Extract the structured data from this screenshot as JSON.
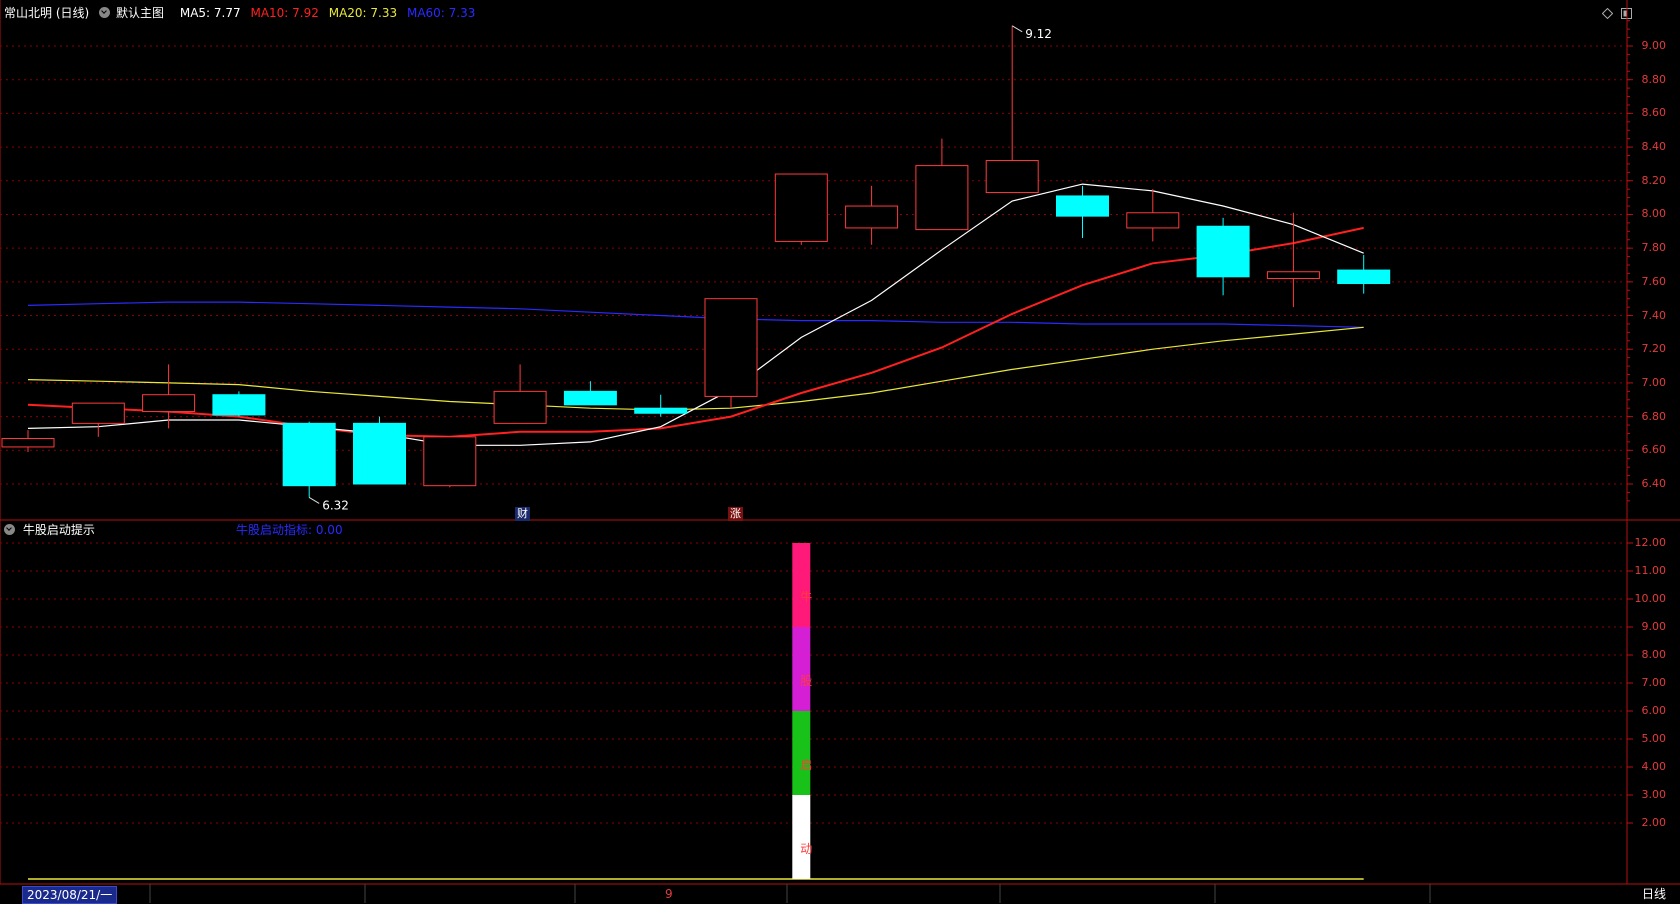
{
  "header": {
    "stock": "常山北明 (日线)",
    "template": "默认主图",
    "ma5": "MA5: 7.77",
    "ma10": "MA10: 7.92",
    "ma20": "MA20: 7.33",
    "ma60": "MA60: 7.33"
  },
  "colors": {
    "ma5": "#ffffff",
    "ma10": "#ff2020",
    "ma20": "#e8e83a",
    "ma60": "#2a2aff",
    "up": "#ff3b3b",
    "down": "#00ffff",
    "axis": "#e23c3c",
    "grid": "#8b0000"
  },
  "price_axis": [
    "9.00",
    "8.80",
    "8.60",
    "8.40",
    "8.20",
    "8.00",
    "7.80",
    "7.60",
    "7.40",
    "7.20",
    "7.00",
    "6.80",
    "6.60",
    "6.40"
  ],
  "annotations": {
    "high": "9.12",
    "low": "6.32",
    "tag_fin": "财",
    "tag_rise": "涨"
  },
  "chart_data": {
    "type": "candlestick",
    "candles": [
      {
        "o": 6.62,
        "c": 6.67,
        "h": 6.72,
        "l": 6.59
      },
      {
        "o": 6.76,
        "c": 6.88,
        "h": 6.88,
        "l": 6.68
      },
      {
        "o": 6.83,
        "c": 6.93,
        "h": 7.11,
        "l": 6.73
      },
      {
        "o": 6.93,
        "c": 6.81,
        "h": 6.95,
        "l": 6.8
      },
      {
        "o": 6.76,
        "c": 6.39,
        "h": 6.77,
        "l": 6.32
      },
      {
        "o": 6.76,
        "c": 6.4,
        "h": 6.8,
        "l": 6.4
      },
      {
        "o": 6.39,
        "c": 6.68,
        "h": 6.68,
        "l": 6.38
      },
      {
        "o": 6.76,
        "c": 6.95,
        "h": 7.11,
        "l": 6.76
      },
      {
        "o": 6.95,
        "c": 6.87,
        "h": 7.01,
        "l": 6.87
      },
      {
        "o": 6.85,
        "c": 6.82,
        "h": 6.93,
        "l": 6.8
      },
      {
        "o": 6.92,
        "c": 7.5,
        "h": 7.5,
        "l": 6.85
      },
      {
        "o": 7.84,
        "c": 8.24,
        "h": 8.24,
        "l": 7.82
      },
      {
        "o": 7.92,
        "c": 8.05,
        "h": 8.17,
        "l": 7.82
      },
      {
        "o": 7.91,
        "c": 8.29,
        "h": 8.45,
        "l": 7.91
      },
      {
        "o": 8.13,
        "c": 8.32,
        "h": 9.12,
        "l": 8.13
      },
      {
        "o": 8.11,
        "c": 7.99,
        "h": 8.17,
        "l": 7.86
      },
      {
        "o": 7.92,
        "c": 8.01,
        "h": 8.15,
        "l": 7.84
      },
      {
        "o": 7.93,
        "c": 7.63,
        "h": 7.98,
        "l": 7.52
      },
      {
        "o": 7.62,
        "c": 7.66,
        "h": 8.01,
        "l": 7.45
      },
      {
        "o": 7.67,
        "c": 7.59,
        "h": 7.76,
        "l": 7.53
      }
    ],
    "ma5": [
      6.73,
      6.74,
      6.78,
      6.78,
      6.74,
      6.7,
      6.63,
      6.63,
      6.65,
      6.74,
      6.96,
      7.27,
      7.49,
      7.79,
      8.08,
      8.18,
      8.14,
      8.05,
      7.94,
      7.77
    ],
    "ma10": [
      6.87,
      6.85,
      6.83,
      6.8,
      6.74,
      6.69,
      6.68,
      6.71,
      6.71,
      6.73,
      6.8,
      6.94,
      7.06,
      7.21,
      7.41,
      7.58,
      7.71,
      7.76,
      7.83,
      7.92
    ],
    "ma20": [
      7.02,
      7.01,
      7.0,
      6.99,
      6.95,
      6.92,
      6.89,
      6.87,
      6.85,
      6.84,
      6.85,
      6.89,
      6.94,
      7.01,
      7.08,
      7.14,
      7.2,
      7.25,
      7.29,
      7.33
    ],
    "ma60": [
      7.46,
      7.47,
      7.48,
      7.48,
      7.47,
      7.46,
      7.45,
      7.44,
      7.42,
      7.4,
      7.38,
      7.37,
      7.37,
      7.36,
      7.36,
      7.35,
      7.35,
      7.35,
      7.34,
      7.33
    ],
    "ylim": [
      6.3,
      9.2
    ]
  },
  "indicator": {
    "title": "牛股启动提示",
    "label": "牛股启动指标: 0.00",
    "axis": [
      "12.00",
      "11.00",
      "10.00",
      "9.00",
      "8.00",
      "7.00",
      "6.00",
      "5.00",
      "4.00",
      "3.00",
      "2.00"
    ],
    "ylim": [
      0,
      12
    ],
    "bar_index": 11,
    "segments": [
      {
        "from": 0,
        "to": 3,
        "color": "#ffffff",
        "char": "动"
      },
      {
        "from": 3,
        "to": 6,
        "color": "#19c219",
        "char": "启"
      },
      {
        "from": 6,
        "to": 9,
        "color": "#d51fd5",
        "char": "股"
      },
      {
        "from": 9,
        "to": 12,
        "color": "#ff1a7a",
        "char": "牛"
      }
    ]
  },
  "footer": {
    "date": "2023/08/21/一",
    "marker": "9",
    "period": "日线"
  }
}
